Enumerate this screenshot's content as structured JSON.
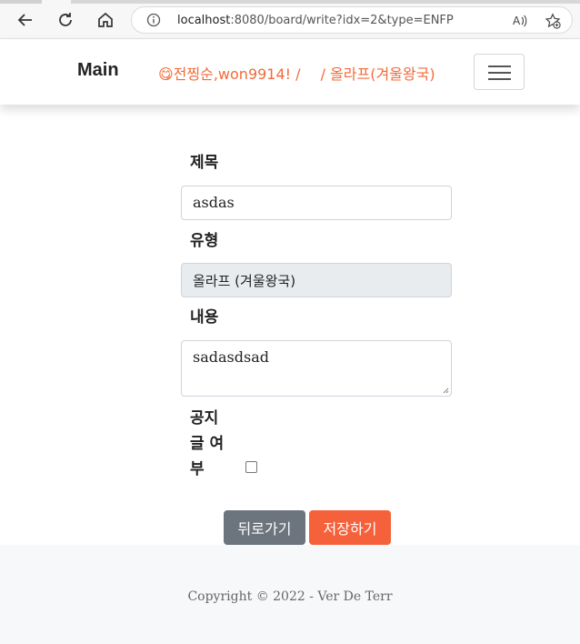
{
  "browser": {
    "url_host": "localhost",
    "url_rest": ":8080/board/write?idx=2&type=ENFP",
    "back_icon": "back-arrow-icon",
    "refresh_icon": "refresh-icon",
    "home_icon": "home-icon",
    "info_icon": "info-icon",
    "read_aloud_icon": "read-aloud-icon",
    "favorite_icon": "add-favorite-icon"
  },
  "header": {
    "brand": "Main",
    "user_text": "😋전찡순,won9914! /",
    "type_text": "/ 올라프(겨울왕국)",
    "menu_icon": "hamburger-menu-icon"
  },
  "form": {
    "title_label": "제목",
    "title_value": "asdas",
    "type_label": "유형",
    "type_value": "올라프 (겨울왕국)",
    "content_label": "내용",
    "content_value": "sadasdsad",
    "notice_label_line1": "공지",
    "notice_label_line2": "글 여",
    "notice_label_line3": "부",
    "notice_checked": false
  },
  "buttons": {
    "back": "뒤로가기",
    "save": "저장하기"
  },
  "footer": {
    "copyright": "Copyright © 2022 - Ver De Terr"
  },
  "colors": {
    "accent": "#f26b3a",
    "save_button": "#f5613a",
    "back_button": "#6c757d"
  }
}
